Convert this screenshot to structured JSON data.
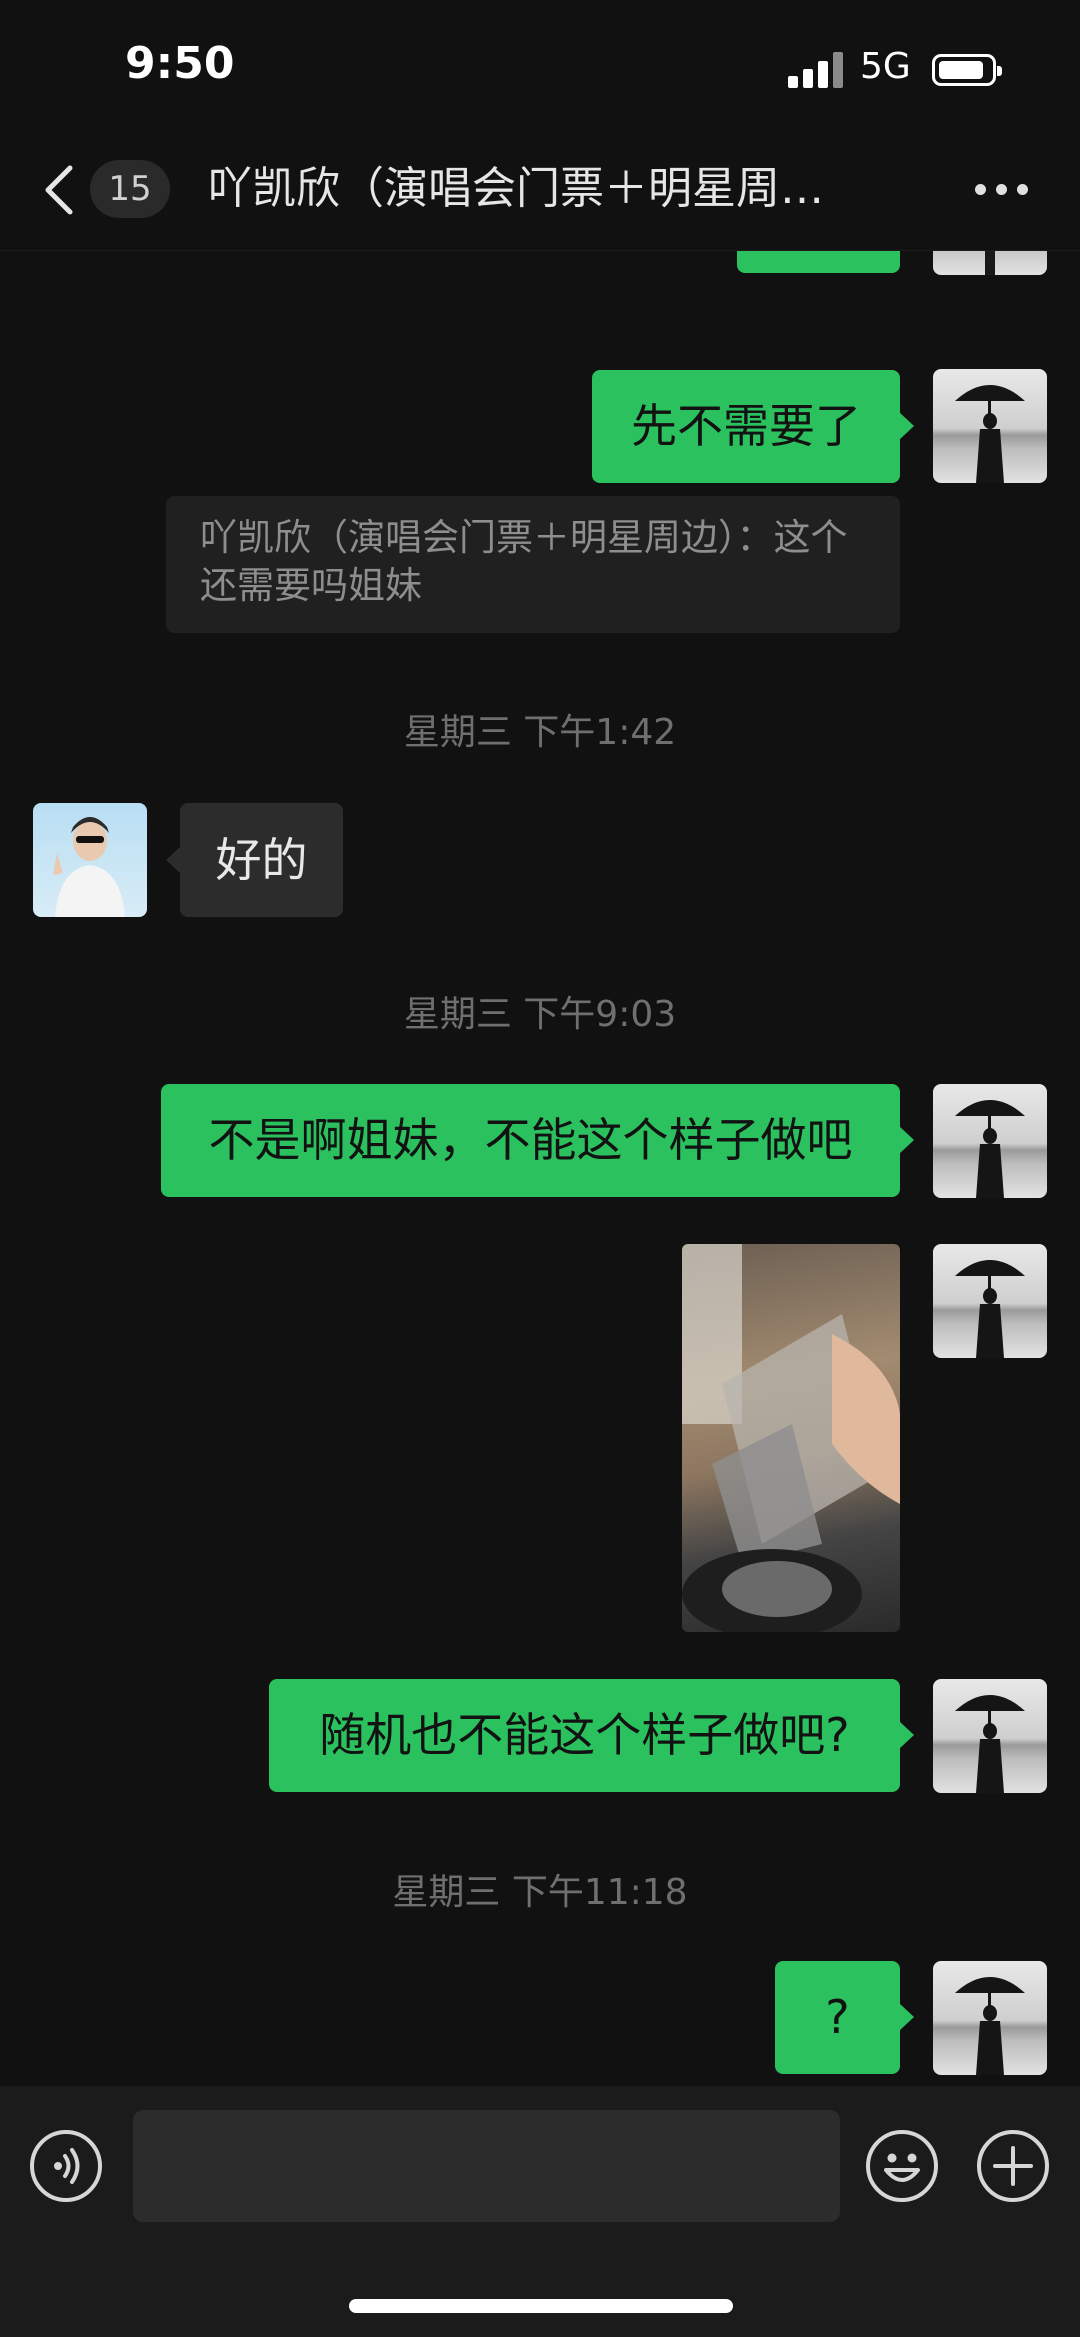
{
  "status_bar": {
    "time": "9:50",
    "network": "5G",
    "signal_bars": 4,
    "battery_level": 0.85
  },
  "nav": {
    "back_icon": "chevron-left-icon",
    "unread_count": "15",
    "title": "吖凯欣（演唱会门票＋明星周…",
    "more_icon": "more-horizontal-icon"
  },
  "messages": {
    "m1_text": "好的",
    "m2_text": "先不需要了",
    "quote_text": "吖凯欣（演唱会门票＋明星周边）：这个还需要吗姐妹",
    "ts1": "星期三 下午1:42",
    "m3_text": "好的",
    "ts2": "星期三 下午9:03",
    "m4_text": "不是啊姐妹，不能这个样子做吧",
    "m6_text": "随机也不能这个样子做吧?",
    "ts3": "星期三 下午11:18",
    "m7_text": "?"
  },
  "input_bar": {
    "voice_icon": "voice-icon",
    "emoji_icon": "emoji-icon",
    "add_icon": "plus-circle-icon",
    "input_value": ""
  },
  "colors": {
    "sent_bubble": "#2bc15f",
    "received_bubble": "#2c2c2c",
    "background": "#111111"
  }
}
